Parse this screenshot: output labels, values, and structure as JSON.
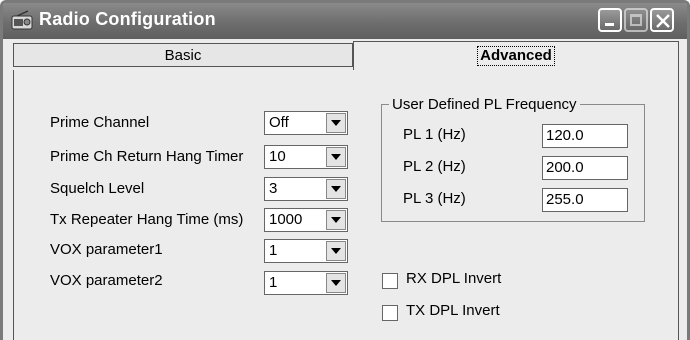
{
  "window": {
    "title": "Radio Configuration"
  },
  "tabs": [
    {
      "label": "Basic",
      "selected": false
    },
    {
      "label": "Advanced",
      "selected": true
    }
  ],
  "fields": [
    {
      "label": "Prime Channel",
      "value": "Off"
    },
    {
      "label": "Prime Ch Return Hang Timer",
      "value": "10"
    },
    {
      "label": "Squelch Level",
      "value": "3"
    },
    {
      "label": "Tx Repeater Hang Time (ms)",
      "value": "1000"
    },
    {
      "label": "VOX parameter1",
      "value": "1"
    },
    {
      "label": "VOX parameter2",
      "value": "1"
    }
  ],
  "pl_group": {
    "title": "User Defined PL Frequency",
    "items": [
      {
        "label": "PL 1 (Hz)",
        "value": "120.0"
      },
      {
        "label": "PL 2 (Hz)",
        "value": "200.0"
      },
      {
        "label": "PL 3 (Hz)",
        "value": "255.0"
      }
    ]
  },
  "checkboxes": [
    {
      "label": "RX DPL Invert",
      "checked": false
    },
    {
      "label": "TX DPL Invert",
      "checked": false
    }
  ],
  "icons": {
    "app": "radio-app-icon",
    "minimize": "minimize-icon",
    "maximize": "maximize-icon",
    "close": "close-icon",
    "dropdown": "chevron-down-icon"
  }
}
